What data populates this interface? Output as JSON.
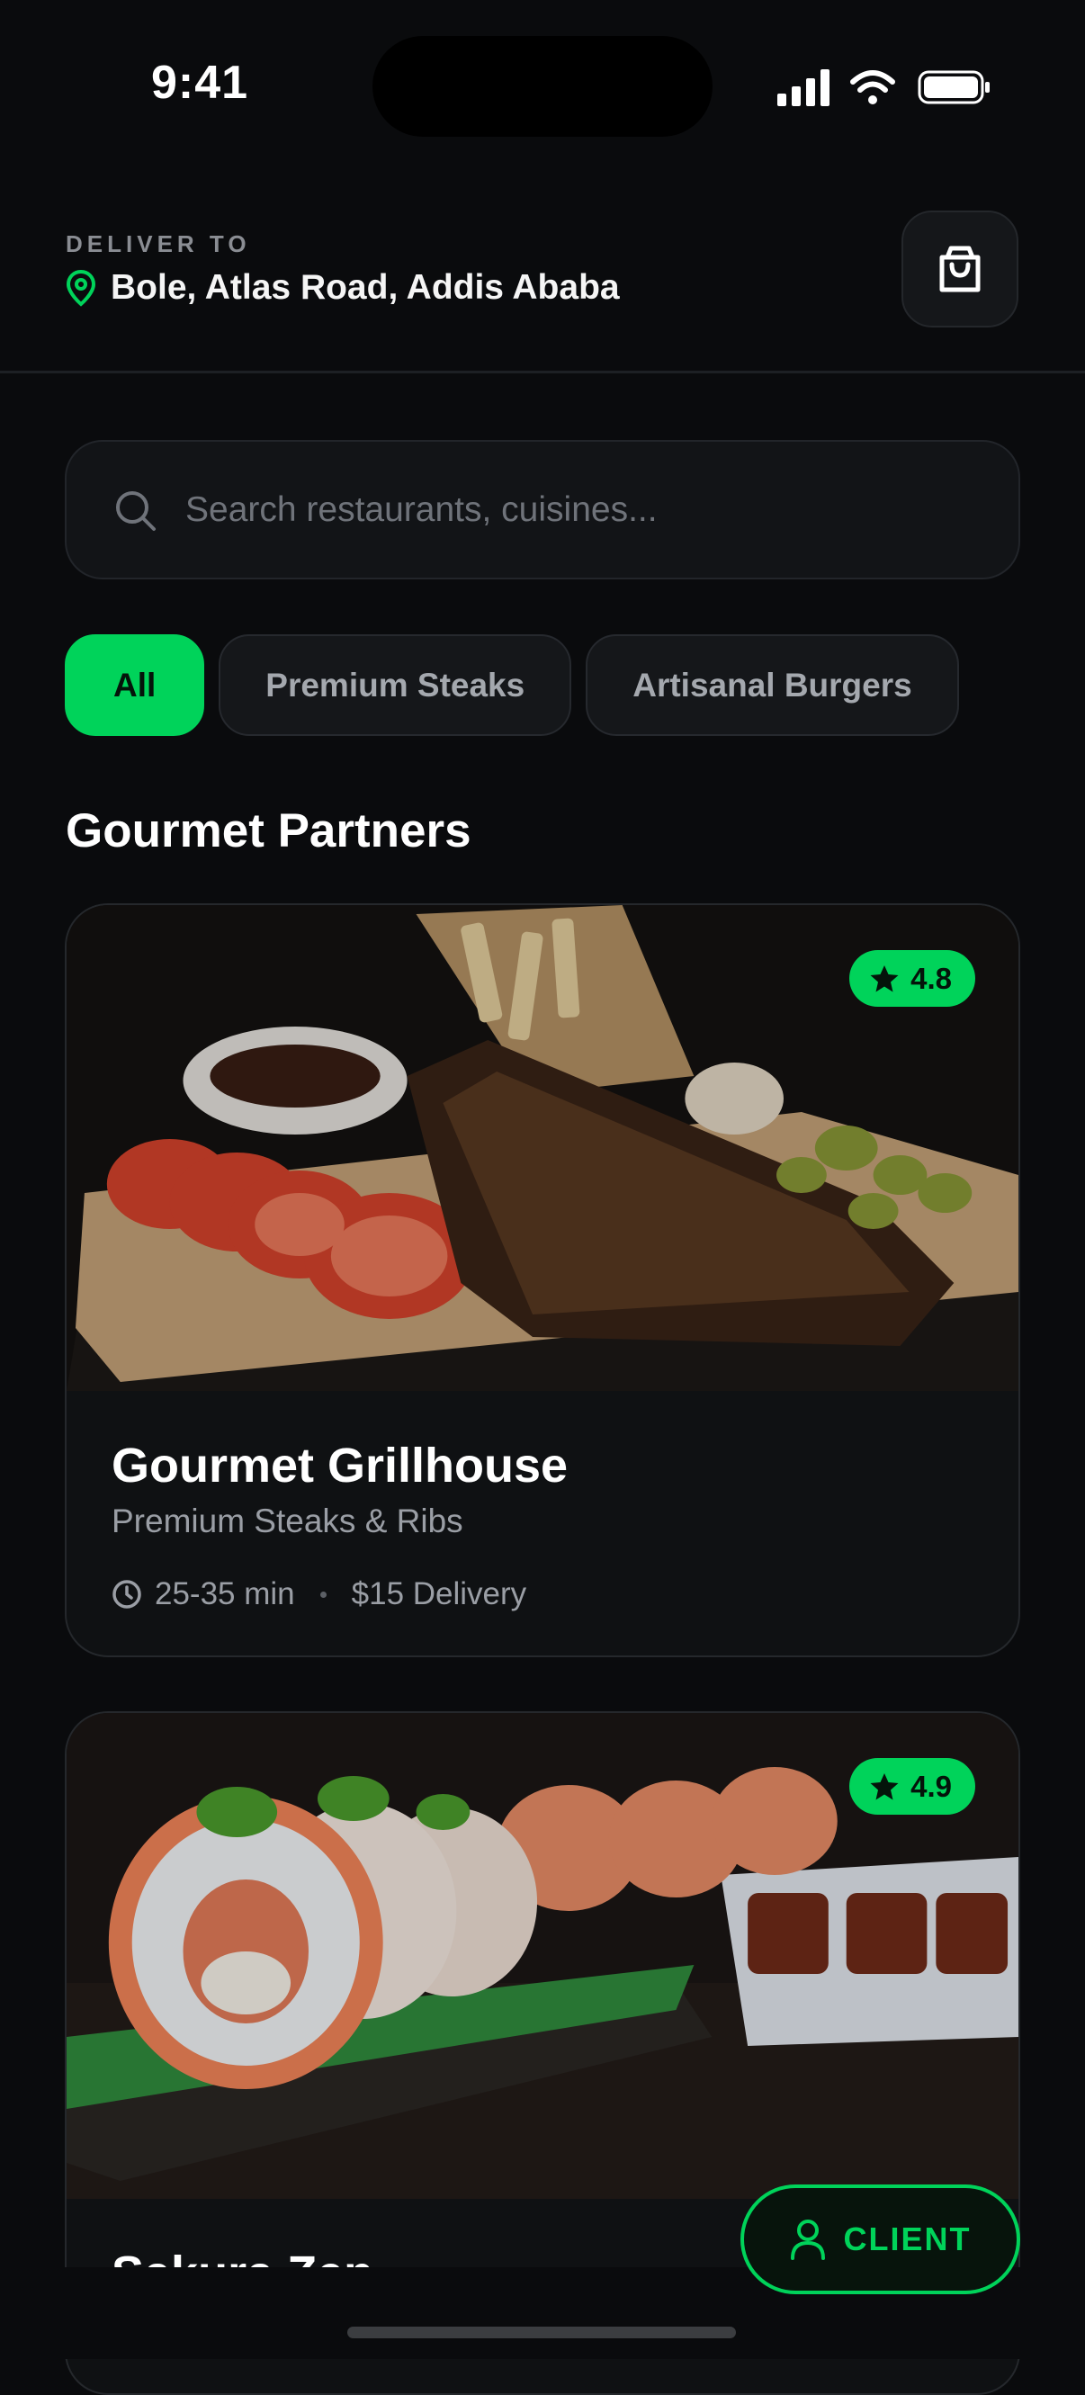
{
  "status_bar": {
    "time": "9:41"
  },
  "header": {
    "deliver_label": "DELIVER TO",
    "address": "Bole, Atlas Road, Addis Ababa"
  },
  "search": {
    "placeholder": "Search restaurants, cuisines..."
  },
  "filters": [
    {
      "label": "All",
      "active": true
    },
    {
      "label": "Premium Steaks",
      "active": false
    },
    {
      "label": "Artisanal Burgers",
      "active": false
    }
  ],
  "section_title": "Gourmet Partners",
  "restaurants": [
    {
      "name": "Gourmet Grillhouse",
      "cuisine": "Premium Steaks & Ribs",
      "rating": "4.8",
      "time": "25-35 min",
      "delivery": "$15 Delivery"
    },
    {
      "name": "Sakura Zen",
      "rating": "4.9"
    }
  ],
  "client_button": {
    "label": "CLIENT"
  },
  "colors": {
    "accent": "#00d35a",
    "background": "#0a0b0d",
    "card": "#0f1113"
  }
}
